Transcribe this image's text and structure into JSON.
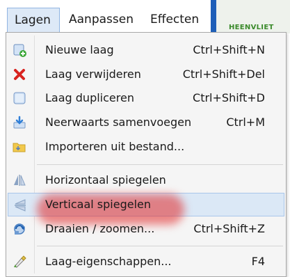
{
  "menubar": {
    "tabs": [
      {
        "label": "Lagen"
      },
      {
        "label": "Aanpassen"
      },
      {
        "label": "Effecten"
      }
    ],
    "map_label": "HEENVLIET"
  },
  "menu": {
    "items": [
      {
        "label": "Nieuwe laag",
        "shortcut": "Ctrl+Shift+N",
        "icon": "new-layer-icon"
      },
      {
        "label": "Laag verwijderen",
        "shortcut": "Ctrl+Shift+Del",
        "icon": "delete-x-icon"
      },
      {
        "label": "Laag dupliceren",
        "shortcut": "Ctrl+Shift+D",
        "icon": "duplicate-layer-icon"
      },
      {
        "label": "Neerwaarts samenvoegen",
        "shortcut": "Ctrl+M",
        "icon": "merge-down-icon"
      },
      {
        "label": "Importeren uit bestand...",
        "shortcut": "",
        "icon": "import-file-icon"
      },
      {
        "label": "Horizontaal spiegelen",
        "shortcut": "",
        "icon": "flip-horizontal-icon"
      },
      {
        "label": "Verticaal spiegelen",
        "shortcut": "",
        "icon": "flip-vertical-icon"
      },
      {
        "label": "Draaien / zoomen...",
        "shortcut": "Ctrl+Shift+Z",
        "icon": "rotate-zoom-icon"
      },
      {
        "label": "Laag-eigenschappen...",
        "shortcut": "F4",
        "icon": "layer-properties-icon"
      }
    ]
  },
  "colors": {
    "menu_bg": "#f5f5f5",
    "hover_bg": "#dbe8f6",
    "highlight_glow": "#e12828",
    "accent_blue": "#1f5fb8"
  }
}
